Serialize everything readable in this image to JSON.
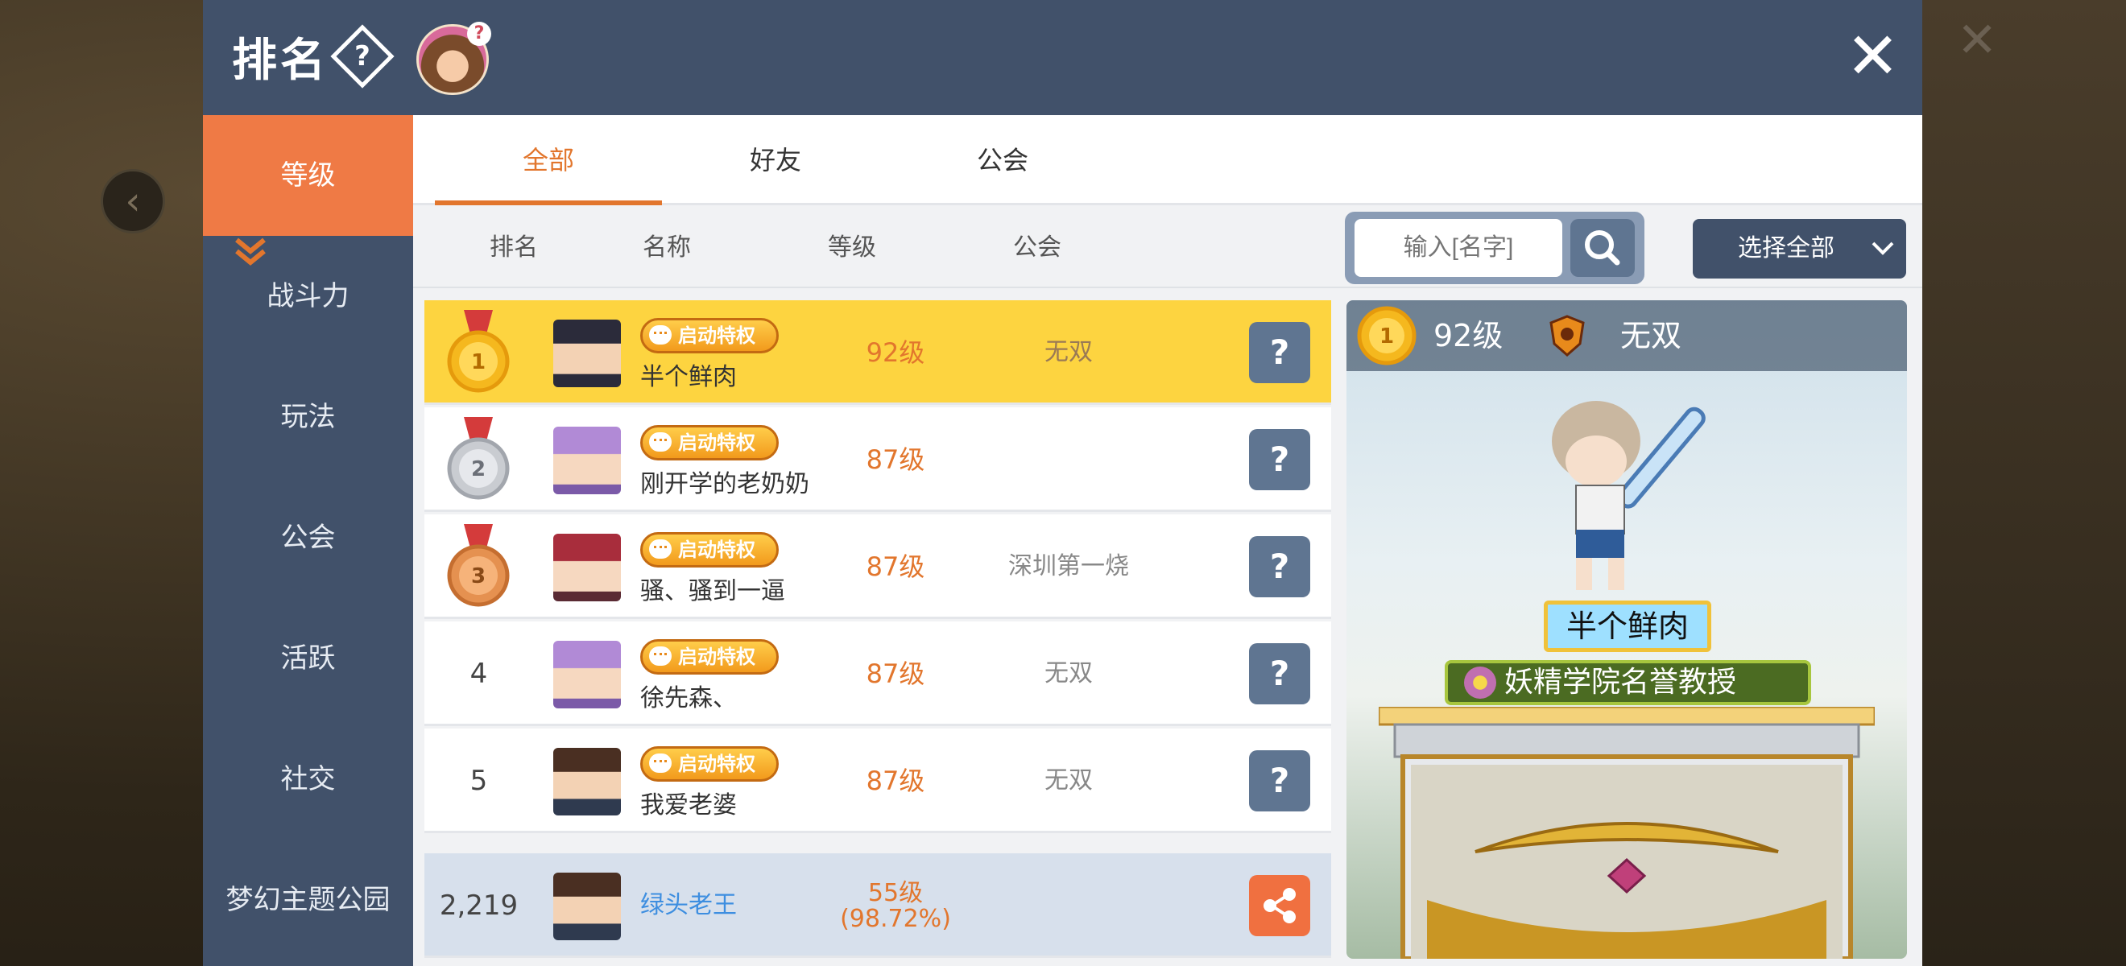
{
  "header": {
    "title": "排名",
    "help_icon": "?",
    "mascot_badge": "?"
  },
  "sidebar": {
    "items": [
      {
        "label": "等级",
        "active": true
      },
      {
        "label": "战斗力"
      },
      {
        "label": "玩法"
      },
      {
        "label": "公会"
      },
      {
        "label": "活跃"
      },
      {
        "label": "社交"
      },
      {
        "label": "梦幻主题公园"
      }
    ]
  },
  "tabs": [
    {
      "label": "全部",
      "active": true
    },
    {
      "label": "好友"
    },
    {
      "label": "公会"
    }
  ],
  "columns": {
    "rank": "排名",
    "name": "名称",
    "level": "等级",
    "guild": "公会"
  },
  "search": {
    "placeholder": "输入[名字]"
  },
  "filter": {
    "label": "选择全部"
  },
  "badge_label": "启动特权",
  "rows": [
    {
      "rank": "1",
      "name": "半个鲜肉",
      "level": "92级",
      "guild": "无双",
      "action": "?"
    },
    {
      "rank": "2",
      "name": "刚开学的老奶奶",
      "level": "87级",
      "guild": "",
      "action": "?"
    },
    {
      "rank": "3",
      "name": "骚、骚到一逼",
      "level": "87级",
      "guild": "深圳第一烧",
      "action": "?"
    },
    {
      "rank": "4",
      "name": "徐先森、",
      "level": "87级",
      "guild": "无双",
      "action": "?"
    },
    {
      "rank": "5",
      "name": "我爱老婆",
      "level": "87级",
      "guild": "无双",
      "action": "?"
    }
  ],
  "my_row": {
    "rank": "2,219",
    "name": "绿头老王",
    "level": "55级",
    "progress": "(98.72%)"
  },
  "preview": {
    "rank": "1",
    "level": "92级",
    "guild": "无双",
    "name": "半个鲜肉",
    "title": "妖精学院名誉教授"
  },
  "colors": {
    "accent": "#ef7a45",
    "header": "#41516a",
    "highlight_row": "#fdd440",
    "level_text": "#e2762d"
  }
}
